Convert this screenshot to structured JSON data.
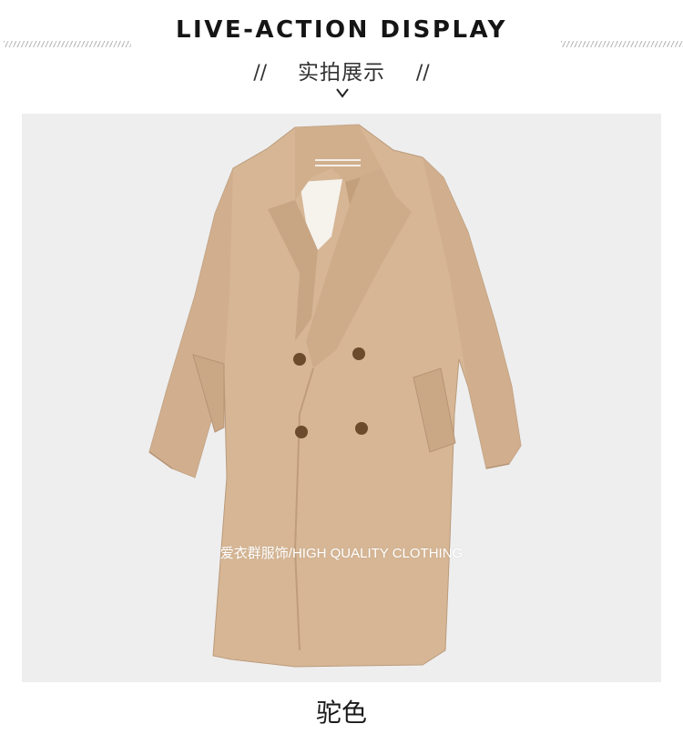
{
  "header": {
    "title": "LIVE-ACTION DISPLAY",
    "subtitle": "实拍展示",
    "slash_left": "//",
    "slash_right": "//",
    "chevron_icon": "chevron-down-icon"
  },
  "photo": {
    "watermark": "爱衣群服饰/HIGH QUALITY CLOTHING",
    "background_color": "#eeeeef",
    "coat_color": "#d6b695"
  },
  "caption": "驼色"
}
